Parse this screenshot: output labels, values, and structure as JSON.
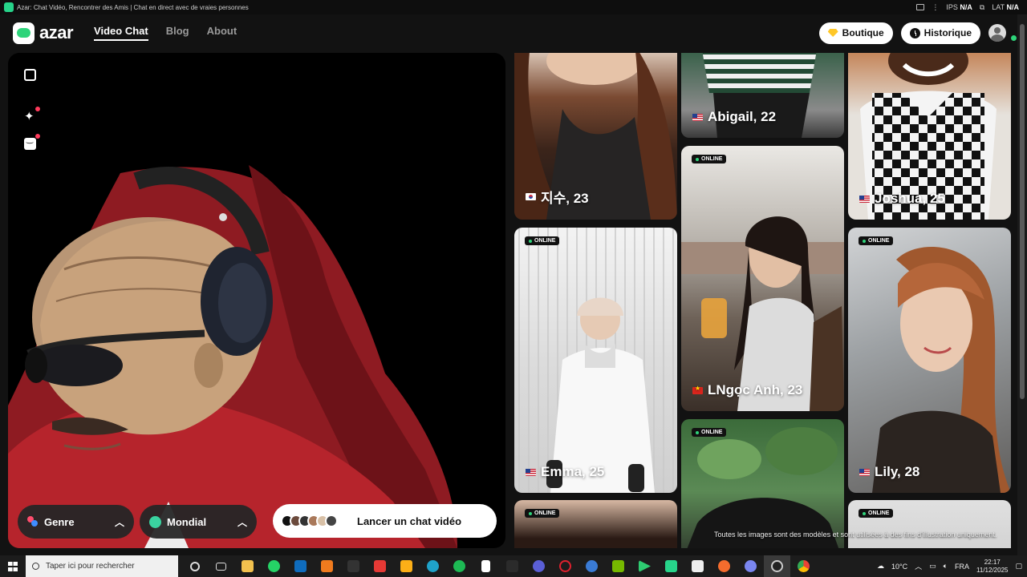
{
  "browser": {
    "title": "Azar: Chat Vidéo, Rencontrer des Amis | Chat en direct avec de vraies personnes",
    "ips_label": "IPS",
    "ips_value": "N/A",
    "lat_label": "LAT",
    "lat_value": "N/A"
  },
  "header": {
    "logo": "azar",
    "nav": [
      "Video Chat",
      "Blog",
      "About"
    ],
    "boutique": "Boutique",
    "historique": "Historique"
  },
  "video": {
    "genre_label": "Genre",
    "region_label": "Mondial",
    "start_label": "Lancer un chat vidéo"
  },
  "online_label": "ONLINE",
  "cards": [
    {
      "name": "지수, 23",
      "flag": "kr",
      "online": false
    },
    {
      "name": "Emma, 25",
      "flag": "us",
      "online": true
    },
    {
      "name": "",
      "flag": "",
      "online": true
    },
    {
      "name": "Abigail, 22",
      "flag": "us",
      "online": false
    },
    {
      "name": "LNgọc Anh, 23",
      "flag": "vn",
      "online": true
    },
    {
      "name": "",
      "flag": "",
      "online": true
    },
    {
      "name": "Joshua, 25",
      "flag": "us",
      "online": false
    },
    {
      "name": "Lily, 28",
      "flag": "us",
      "online": true
    },
    {
      "name": "",
      "flag": "",
      "online": true
    }
  ],
  "disclaimer": "Toutes les images sont des modèles et sont utilisées à des fins d'illustration uniquement.",
  "taskbar": {
    "search_placeholder": "Taper ici pour rechercher",
    "weather": "10°C",
    "lang": "FRA",
    "time": "22:17",
    "date": "11/12/2025"
  },
  "colors": {
    "accent": "#2ed47a",
    "online_dot": "#2ed47a",
    "notification": "#ff3b5c",
    "boutique_gem": "#ffc727"
  }
}
